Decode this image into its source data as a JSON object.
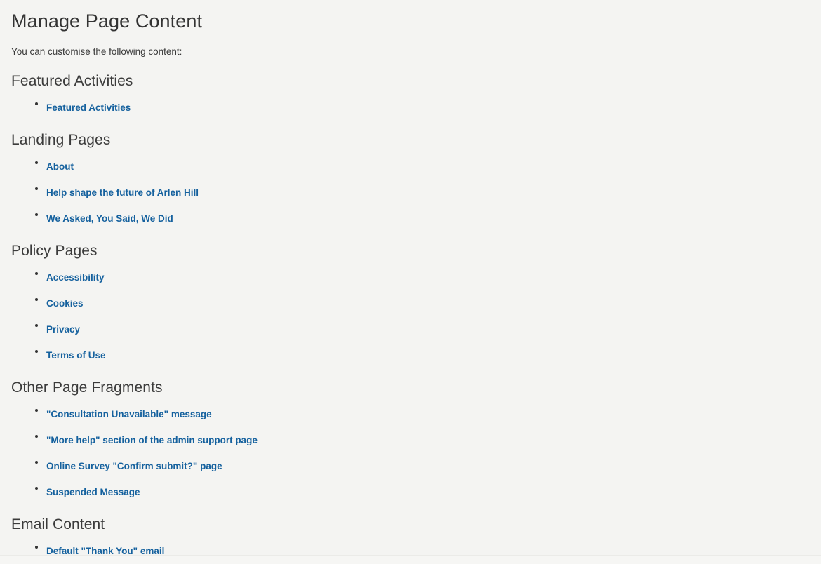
{
  "page": {
    "title": "Manage Page Content",
    "intro": "You can customise the following content:"
  },
  "colors": {
    "background": "#f4f4f2",
    "link": "#15619e",
    "heading": "#3b3b3b",
    "title": "#333333",
    "bullet": "#333333"
  },
  "sections": [
    {
      "heading": "Featured Activities",
      "links": [
        {
          "label": "Featured Activities"
        }
      ]
    },
    {
      "heading": "Landing Pages",
      "links": [
        {
          "label": "About"
        },
        {
          "label": "Help shape the future of Arlen Hill"
        },
        {
          "label": "We Asked, You Said, We Did"
        }
      ]
    },
    {
      "heading": "Policy Pages",
      "links": [
        {
          "label": "Accessibility"
        },
        {
          "label": "Cookies"
        },
        {
          "label": "Privacy"
        },
        {
          "label": "Terms of Use"
        }
      ]
    },
    {
      "heading": "Other Page Fragments",
      "links": [
        {
          "label": "\"Consultation Unavailable\" message"
        },
        {
          "label": "\"More help\" section of the admin support page"
        },
        {
          "label": "Online Survey \"Confirm submit?\" page"
        },
        {
          "label": "Suspended Message"
        }
      ]
    },
    {
      "heading": "Email Content",
      "links": [
        {
          "label": "Default \"Thank You\" email"
        }
      ]
    }
  ]
}
